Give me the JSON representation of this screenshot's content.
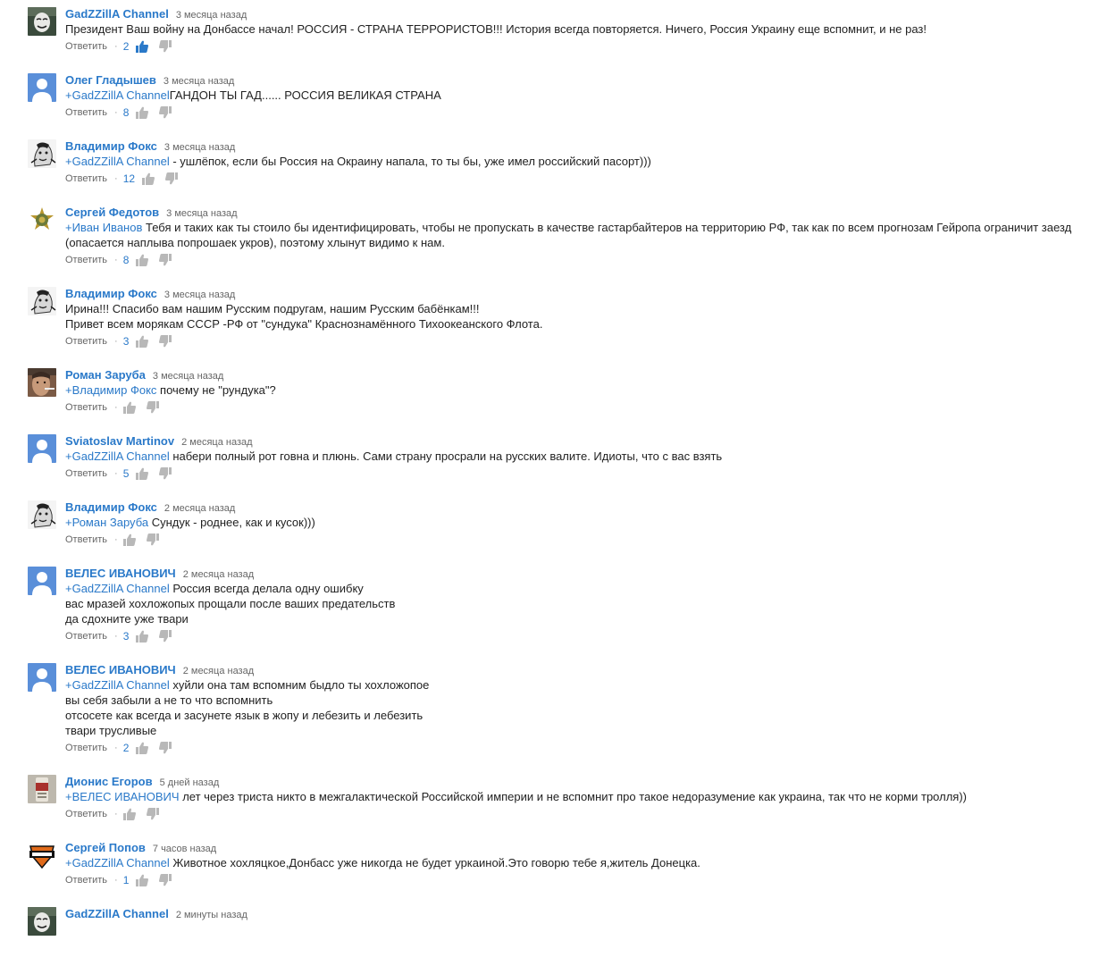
{
  "labels": {
    "reply": "Ответить"
  },
  "icons": {
    "like": "thumbs-up-icon",
    "dislike": "thumbs-down-icon"
  },
  "colors": {
    "link": "#2a79c9",
    "icon_idle": "#b8b8b8",
    "icon_active": "#2a79c9"
  },
  "comments": [
    {
      "author": "GadZZillA Channel",
      "time": "3 месяца назад",
      "avatar": "dark-mask-avatar",
      "lines": [
        {
          "mention": "",
          "text": "Президент Ваш войну на Донбассе начал! РОССИЯ - СТРАНА ТЕРРОРИСТОВ!!! История всегда повторяется. Ничего, Россия Украину еще вспомнит, и не раз!"
        }
      ],
      "likes": "2",
      "liked": true
    },
    {
      "author": "Олег Гладышев",
      "time": "3 месяца назад",
      "avatar": "default-user-avatar",
      "lines": [
        {
          "mention": "+GadZZillA Channel",
          "text": "ГАНДОН ТЫ ГАД...... РОССИЯ ВЕЛИКАЯ СТРАНА"
        }
      ],
      "likes": "8",
      "liked": false
    },
    {
      "author": "Владимир Фокс",
      "time": "3 месяца назад",
      "avatar": "sketch-face-avatar",
      "lines": [
        {
          "mention": "+GadZZillA Channel",
          "text": " - ушлёпок, если бы Россия на Окраину напала, то ты бы, уже имел российский пасорт)))"
        }
      ],
      "likes": "12",
      "liked": false
    },
    {
      "author": "Сергей Федотов",
      "time": "3 месяца назад",
      "avatar": "emblem-avatar",
      "lines": [
        {
          "mention": "+Иван Иванов",
          "text": " Тебя и таких как ты стоило бы идентифицировать, чтобы не пропускать  в качестве гастарбайтеров на территорию РФ, так как по всем прогнозам Гейропа ограничит заезд (опасается наплыва попрошаек укров), поэтому хлынут видимо к нам.",
          "wrap": true
        }
      ],
      "likes": "8",
      "liked": false
    },
    {
      "author": "Владимир Фокс",
      "time": "3 месяца назад",
      "avatar": "sketch-face-avatar",
      "lines": [
        {
          "mention": "",
          "text": "Ирина!!! Спасибо вам нашим Русским подругам, нашим Русским бабёнкам!!!"
        },
        {
          "mention": "",
          "text": "Привет всем морякам СССР -РФ от \"сундука\" Краснознамённого Тихоокеанского Флота."
        }
      ],
      "likes": "3",
      "liked": false
    },
    {
      "author": "Роман Заруба",
      "time": "3 месяца назад",
      "avatar": "photo-avatar",
      "lines": [
        {
          "mention": "+Владимир Фокс",
          "text": "  почему не \"рундука\"?"
        }
      ],
      "likes": "",
      "liked": false
    },
    {
      "author": "Sviatoslav Martinov",
      "time": "2 месяца назад",
      "avatar": "default-user-avatar",
      "lines": [
        {
          "mention": "+GadZZillA Channel",
          "text": " набери полный рот говна и плюнь. Сами страну просрали на русских валите. Идиоты, что с вас взять"
        }
      ],
      "likes": "5",
      "liked": false
    },
    {
      "author": "Владимир Фокс",
      "time": "2 месяца назад",
      "avatar": "sketch-face-avatar",
      "lines": [
        {
          "mention": "+Роман Заруба",
          "text": " Сундук - роднее, как и кусок)))"
        }
      ],
      "likes": "",
      "liked": false
    },
    {
      "author": "ВЕЛЕС ИВАНОВИЧ",
      "time": "2 месяца назад",
      "avatar": "default-user-avatar",
      "lines": [
        {
          "mention": "+GadZZillA Channel",
          "text": " Россия всегда делала одну ошибку"
        },
        {
          "mention": "",
          "text": "вас мразей хохложопых прощали после ваших предательств"
        },
        {
          "mention": "",
          "text": "да сдохните уже твари"
        }
      ],
      "likes": "3",
      "liked": false
    },
    {
      "author": "ВЕЛЕС ИВАНОВИЧ",
      "time": "2 месяца назад",
      "avatar": "default-user-avatar",
      "lines": [
        {
          "mention": "+GadZZillA Channel",
          "text": " хуйли она там вспомним быдло ты хохложопое"
        },
        {
          "mention": "",
          "text": "вы себя забыли а не то что вспомнить"
        },
        {
          "mention": "",
          "text": "отсосете как всегда и засунете язык в жопу и лебезить и лебезить"
        },
        {
          "mention": "",
          "text": "твари трусливые"
        }
      ],
      "likes": "2",
      "liked": false
    },
    {
      "author": "Дионис Егоров",
      "time": "5 дней назад",
      "avatar": "label-avatar",
      "lines": [
        {
          "mention": "+ВЕЛЕС ИВАНОВИЧ",
          "text": " лет через триста никто в межгалактической Российской империи и не вспомнит про такое недоразумение как украина, так что не корми тролля))"
        }
      ],
      "likes": "",
      "liked": false
    },
    {
      "author": "Сергей Попов",
      "time": "7 часов назад",
      "avatar": "harley-logo-avatar",
      "lines": [
        {
          "mention": "+GadZZillA Channel",
          "text": " Животное хохляцкое,Донбасс уже никогда не будет уркаиной.Это говорю тебе я,житель Донецка."
        }
      ],
      "likes": "1",
      "liked": false
    },
    {
      "author": "GadZZillA Channel",
      "time": "2 минуты назад",
      "avatar": "dark-mask-avatar",
      "lines": [],
      "likes": "",
      "liked": false
    }
  ]
}
